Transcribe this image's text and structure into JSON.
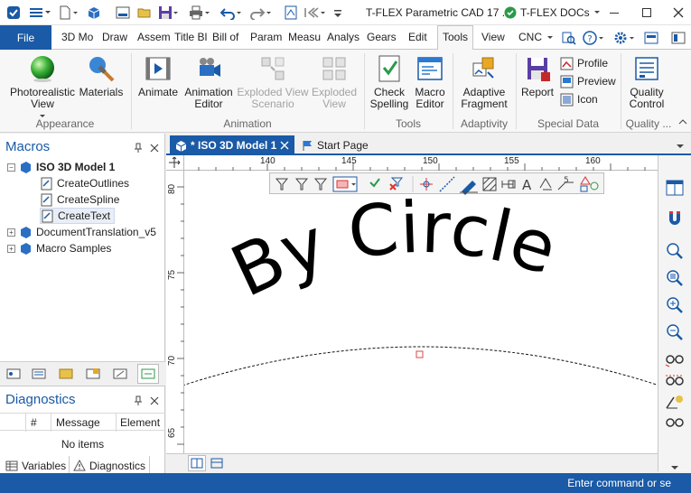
{
  "window": {
    "title": "T-FLEX Parametric CAD 17 ...",
    "docs_button": "T-FLEX DOCs"
  },
  "ribbon_tabs": {
    "file": "File",
    "tabs": [
      "3D Mo",
      "Draw",
      "Assem",
      "Title Bl",
      "Bill of",
      "Param",
      "Measu",
      "Analys",
      "Gears",
      "Edit",
      "Tools",
      "View",
      "CNC"
    ],
    "active": "Tools"
  },
  "ribbon": {
    "photorealistic_view": "Photorealistic View",
    "materials": "Materials",
    "appearance_group": "Appearance",
    "animate": "Animate",
    "animation_editor": "Animation Editor",
    "exploded_view_scenario": "Exploded View Scenario",
    "exploded_view": "Exploded View",
    "animation_group": "Animation",
    "check_spelling": "Check Spelling",
    "macro_editor": "Macro Editor",
    "tools_group": "Tools",
    "adaptive_fragment": "Adaptive Fragment",
    "adaptivity_group": "Adaptivity",
    "report": "Report",
    "profile": "Profile",
    "preview": "Preview",
    "icon": "Icon",
    "special_data_group": "Special Data",
    "quality_control": "Quality Control",
    "quality_group": "Quality ..."
  },
  "macros_panel": {
    "title": "Macros",
    "tree": {
      "root": "ISO 3D Model 1",
      "children": [
        "CreateOutlines",
        "CreateSpline",
        "CreateText"
      ],
      "others": [
        "DocumentTranslation_v5",
        "Macro Samples"
      ]
    }
  },
  "diagnostics_panel": {
    "title": "Diagnostics",
    "columns": [
      "#",
      "Message",
      "Element"
    ],
    "empty_text": "No items",
    "tabs": [
      "Variables",
      "Diagnostics"
    ]
  },
  "document_tabs": [
    "* ISO 3D Model 1",
    "Start Page"
  ],
  "ruler": {
    "top_labels": [
      "140",
      "145",
      "150",
      "155",
      "160"
    ],
    "left_labels": [
      "80",
      "75",
      "70",
      "65"
    ]
  },
  "canvas": {
    "text": "By Circle"
  },
  "status": {
    "command_prompt": "Enter command or se"
  },
  "colors": {
    "accent": "#1a5aa6",
    "file_tab": "#1a5aa6",
    "status_bar": "#1a5aa6"
  }
}
